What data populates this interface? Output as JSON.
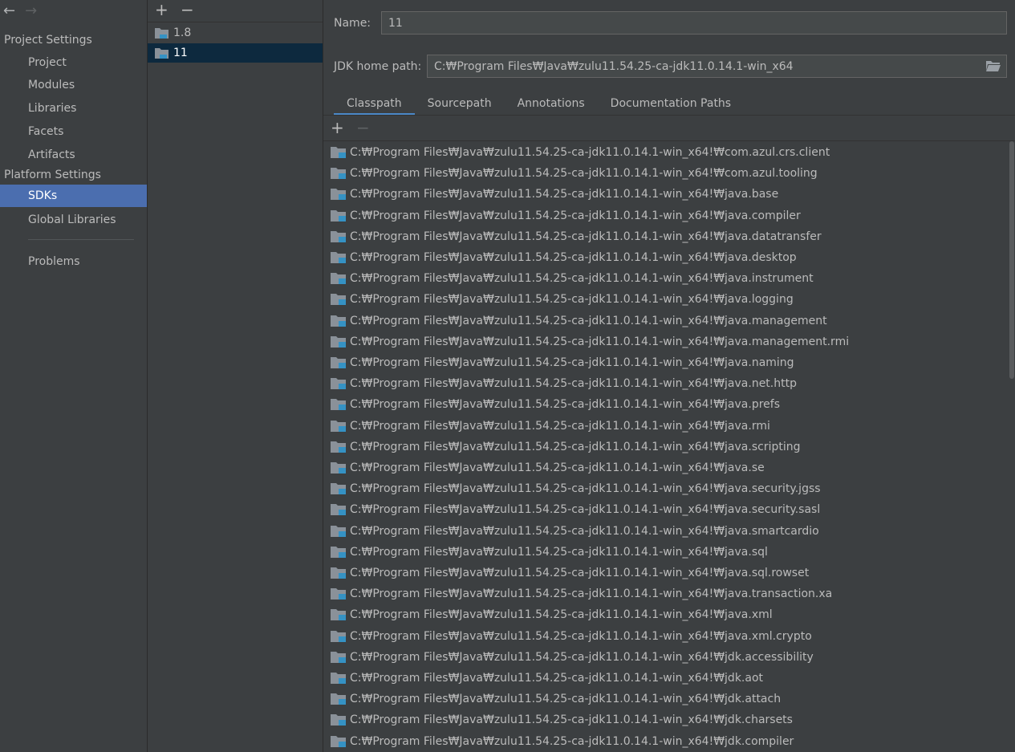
{
  "nav": {
    "back": "←",
    "forward": "→"
  },
  "sidebar": {
    "project_settings_header": "Project Settings",
    "project_items": [
      "Project",
      "Modules",
      "Libraries",
      "Facets",
      "Artifacts"
    ],
    "platform_settings_header": "Platform Settings",
    "platform_items": [
      "SDKs",
      "Global Libraries"
    ],
    "selected": "SDKs",
    "problems": "Problems"
  },
  "sdk_list": {
    "add": "+",
    "remove": "−",
    "items": [
      "1.8",
      "11"
    ],
    "selected": "11"
  },
  "details": {
    "name_label": "Name:",
    "name_value": "11",
    "jdk_home_label": "JDK home path:",
    "jdk_home_value": "C:₩Program Files₩Java₩zulu11.54.25-ca-jdk11.0.14.1-win_x64",
    "tabs": [
      "Classpath",
      "Sourcepath",
      "Annotations",
      "Documentation Paths"
    ],
    "active_tab": "Classpath",
    "add": "+",
    "remove": "−"
  },
  "classpath": [
    "C:₩Program Files₩Java₩zulu11.54.25-ca-jdk11.0.14.1-win_x64!₩com.azul.crs.client",
    "C:₩Program Files₩Java₩zulu11.54.25-ca-jdk11.0.14.1-win_x64!₩com.azul.tooling",
    "C:₩Program Files₩Java₩zulu11.54.25-ca-jdk11.0.14.1-win_x64!₩java.base",
    "C:₩Program Files₩Java₩zulu11.54.25-ca-jdk11.0.14.1-win_x64!₩java.compiler",
    "C:₩Program Files₩Java₩zulu11.54.25-ca-jdk11.0.14.1-win_x64!₩java.datatransfer",
    "C:₩Program Files₩Java₩zulu11.54.25-ca-jdk11.0.14.1-win_x64!₩java.desktop",
    "C:₩Program Files₩Java₩zulu11.54.25-ca-jdk11.0.14.1-win_x64!₩java.instrument",
    "C:₩Program Files₩Java₩zulu11.54.25-ca-jdk11.0.14.1-win_x64!₩java.logging",
    "C:₩Program Files₩Java₩zulu11.54.25-ca-jdk11.0.14.1-win_x64!₩java.management",
    "C:₩Program Files₩Java₩zulu11.54.25-ca-jdk11.0.14.1-win_x64!₩java.management.rmi",
    "C:₩Program Files₩Java₩zulu11.54.25-ca-jdk11.0.14.1-win_x64!₩java.naming",
    "C:₩Program Files₩Java₩zulu11.54.25-ca-jdk11.0.14.1-win_x64!₩java.net.http",
    "C:₩Program Files₩Java₩zulu11.54.25-ca-jdk11.0.14.1-win_x64!₩java.prefs",
    "C:₩Program Files₩Java₩zulu11.54.25-ca-jdk11.0.14.1-win_x64!₩java.rmi",
    "C:₩Program Files₩Java₩zulu11.54.25-ca-jdk11.0.14.1-win_x64!₩java.scripting",
    "C:₩Program Files₩Java₩zulu11.54.25-ca-jdk11.0.14.1-win_x64!₩java.se",
    "C:₩Program Files₩Java₩zulu11.54.25-ca-jdk11.0.14.1-win_x64!₩java.security.jgss",
    "C:₩Program Files₩Java₩zulu11.54.25-ca-jdk11.0.14.1-win_x64!₩java.security.sasl",
    "C:₩Program Files₩Java₩zulu11.54.25-ca-jdk11.0.14.1-win_x64!₩java.smartcardio",
    "C:₩Program Files₩Java₩zulu11.54.25-ca-jdk11.0.14.1-win_x64!₩java.sql",
    "C:₩Program Files₩Java₩zulu11.54.25-ca-jdk11.0.14.1-win_x64!₩java.sql.rowset",
    "C:₩Program Files₩Java₩zulu11.54.25-ca-jdk11.0.14.1-win_x64!₩java.transaction.xa",
    "C:₩Program Files₩Java₩zulu11.54.25-ca-jdk11.0.14.1-win_x64!₩java.xml",
    "C:₩Program Files₩Java₩zulu11.54.25-ca-jdk11.0.14.1-win_x64!₩java.xml.crypto",
    "C:₩Program Files₩Java₩zulu11.54.25-ca-jdk11.0.14.1-win_x64!₩jdk.accessibility",
    "C:₩Program Files₩Java₩zulu11.54.25-ca-jdk11.0.14.1-win_x64!₩jdk.aot",
    "C:₩Program Files₩Java₩zulu11.54.25-ca-jdk11.0.14.1-win_x64!₩jdk.attach",
    "C:₩Program Files₩Java₩zulu11.54.25-ca-jdk11.0.14.1-win_x64!₩jdk.charsets",
    "C:₩Program Files₩Java₩zulu11.54.25-ca-jdk11.0.14.1-win_x64!₩jdk.compiler"
  ],
  "colors": {
    "background": "#3c3f41",
    "selection": "#4b6eaf",
    "list_selection": "#0d293e",
    "tab_underline": "#4a88c7",
    "text": "#bbbbbb"
  }
}
